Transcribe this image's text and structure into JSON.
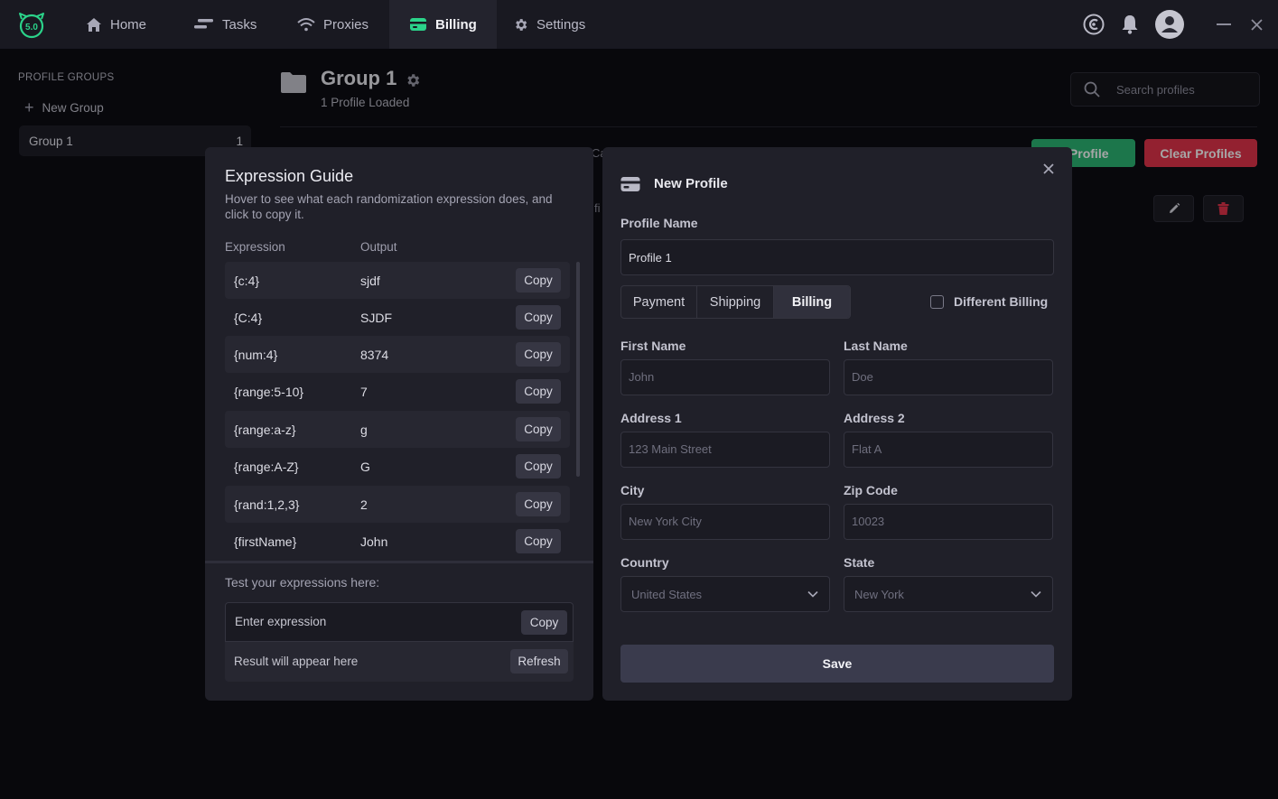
{
  "app": {
    "logo_text": "5.0",
    "accent_color": "#2bb673",
    "danger_color": "#e2344b"
  },
  "nav": {
    "items": [
      {
        "label": "Home",
        "icon": "home-icon"
      },
      {
        "label": "Tasks",
        "icon": "tasks-icon"
      },
      {
        "label": "Proxies",
        "icon": "wifi-icon"
      },
      {
        "label": "Billing",
        "icon": "card-icon",
        "active": true
      },
      {
        "label": "Settings",
        "icon": "gear-icon"
      }
    ]
  },
  "sidebar": {
    "title": "PROFILE GROUPS",
    "new_group_label": "New Group",
    "groups": [
      {
        "name": "Group 1",
        "count": "1"
      }
    ]
  },
  "main": {
    "group_title": "Group 1",
    "profiles_loaded": "1 Profile Loaded",
    "search_placeholder": "Search profiles",
    "add_profile_label": "d Profile",
    "clear_profiles_label": "Clear Profiles",
    "peek_header_fragment": "Ca",
    "peek_row_fragment": "fi"
  },
  "guide": {
    "title": "Expression Guide",
    "description": "Hover to see what each randomization expression does, and click to copy it.",
    "col_expression": "Expression",
    "col_output": "Output",
    "copy_label": "Copy",
    "rows": [
      {
        "expr": "{c:4}",
        "out": "sjdf"
      },
      {
        "expr": "{C:4}",
        "out": "SJDF"
      },
      {
        "expr": "{num:4}",
        "out": "8374"
      },
      {
        "expr": "{range:5-10}",
        "out": "7"
      },
      {
        "expr": "{range:a-z}",
        "out": "g"
      },
      {
        "expr": "{range:A-Z}",
        "out": "G"
      },
      {
        "expr": "{rand:1,2,3}",
        "out": "2"
      },
      {
        "expr": "{firstName}",
        "out": "John"
      }
    ],
    "test_label": "Test your expressions here:",
    "test_placeholder": "Enter expression",
    "test_copy_label": "Copy",
    "result_text": "Result will appear here",
    "refresh_label": "Refresh"
  },
  "modal": {
    "title": "New Profile",
    "profile_name_label": "Profile Name",
    "profile_name_value": "Profile 1",
    "tabs": [
      "Payment",
      "Shipping",
      "Billing"
    ],
    "active_tab": "Billing",
    "different_billing_label": "Different Billing",
    "fields": {
      "first_name": {
        "label": "First Name",
        "placeholder": "John"
      },
      "last_name": {
        "label": "Last Name",
        "placeholder": "Doe"
      },
      "address1": {
        "label": "Address 1",
        "placeholder": "123 Main Street"
      },
      "address2": {
        "label": "Address 2",
        "placeholder": "Flat A"
      },
      "city": {
        "label": "City",
        "placeholder": "New York City"
      },
      "zip": {
        "label": "Zip Code",
        "placeholder": "10023"
      },
      "country": {
        "label": "Country",
        "value": "United States"
      },
      "state": {
        "label": "State",
        "value": "New York"
      }
    },
    "save_label": "Save"
  }
}
